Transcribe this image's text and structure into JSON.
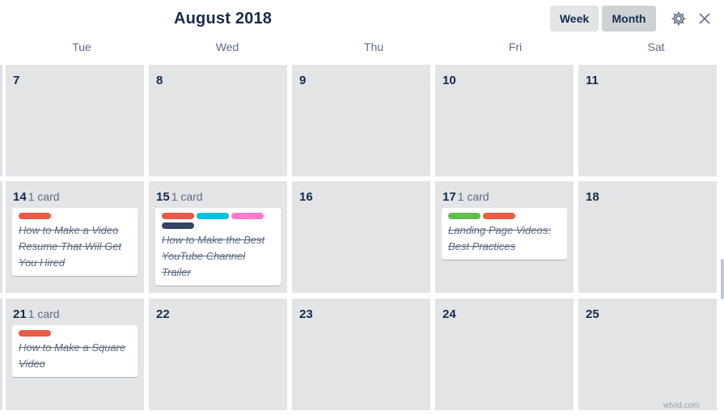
{
  "header": {
    "title": "August 2018",
    "week_label": "Week",
    "month_label": "Month",
    "settings_icon": "gear-icon",
    "close_icon": "close-icon"
  },
  "days_of_week": [
    "Tue",
    "Wed",
    "Thu",
    "Fri",
    "Sat"
  ],
  "weeks": [
    {
      "days": [
        {
          "date": "7",
          "count": "",
          "cards": []
        },
        {
          "date": "8",
          "count": "",
          "cards": []
        },
        {
          "date": "9",
          "count": "",
          "cards": []
        },
        {
          "date": "10",
          "count": "",
          "cards": []
        },
        {
          "date": "11",
          "count": "",
          "cards": []
        }
      ]
    },
    {
      "days": [
        {
          "date": "14",
          "count": "1 card",
          "cards": [
            {
              "title": "How to Make a Video Resume That Will Get You Hired",
              "labels": [
                "#eb5a46"
              ]
            }
          ]
        },
        {
          "date": "15",
          "count": "1 card",
          "cards": [
            {
              "title": "How to Make the Best YouTube Channel Trailer",
              "labels": [
                "#eb5a46",
                "#00c2e0",
                "#ff78cb",
                "#344563"
              ]
            }
          ]
        },
        {
          "date": "16",
          "count": "",
          "cards": []
        },
        {
          "date": "17",
          "count": "1 card",
          "cards": [
            {
              "title": "Landing Page Videos: Best Practices",
              "labels": [
                "#61bd4f",
                "#eb5a46"
              ]
            }
          ]
        },
        {
          "date": "18",
          "count": "",
          "cards": []
        }
      ]
    },
    {
      "days": [
        {
          "date": "21",
          "count": "1 card",
          "cards": [
            {
              "title": "How to Make a Square Video",
              "labels": [
                "#eb5a46"
              ]
            }
          ]
        },
        {
          "date": "22",
          "count": "",
          "cards": []
        },
        {
          "date": "23",
          "count": "",
          "cards": []
        },
        {
          "date": "24",
          "count": "",
          "cards": []
        },
        {
          "date": "25",
          "count": "",
          "cards": []
        }
      ]
    }
  ],
  "watermark": "wtvid.com"
}
